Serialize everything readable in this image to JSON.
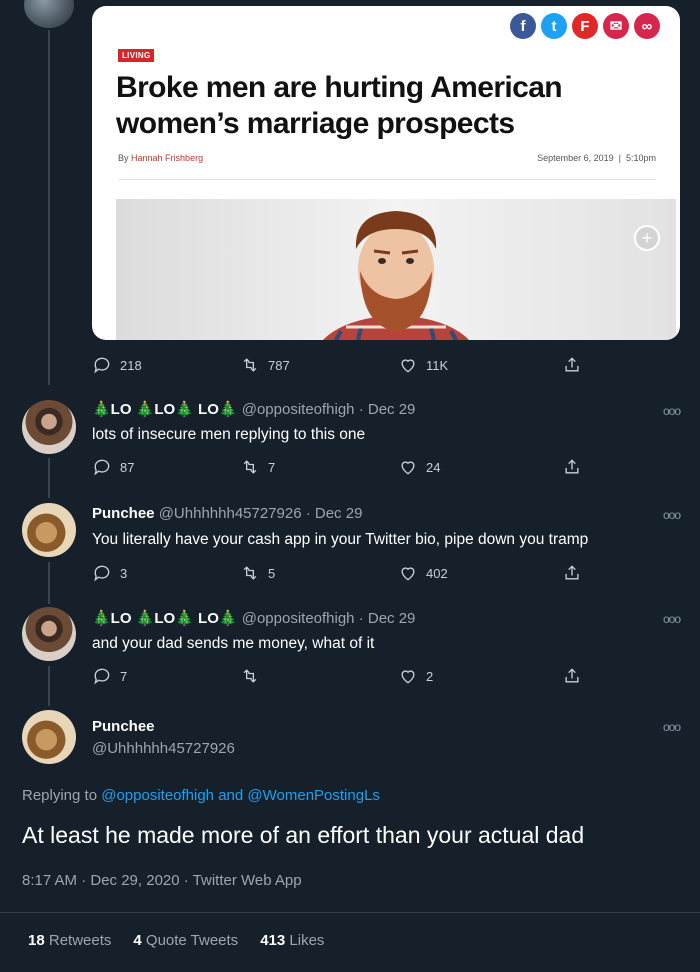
{
  "article": {
    "section_tag": "LIVING",
    "headline": "Broke men are hurting American women’s marriage prospects",
    "byline_prefix": "By",
    "author": "Hannah Frishberg",
    "date": "September 6, 2019",
    "time": "5:10pm",
    "share_icons": [
      {
        "name": "facebook-icon",
        "glyph": "f",
        "color": "#3b5998"
      },
      {
        "name": "twitter-icon",
        "glyph": "t",
        "color": "#1da1f2"
      },
      {
        "name": "flipboard-icon",
        "glyph": "F",
        "color": "#e12828"
      },
      {
        "name": "email-icon",
        "glyph": "✉",
        "color": "#d6264c"
      },
      {
        "name": "link-icon",
        "glyph": "∞",
        "color": "#d6264c"
      }
    ]
  },
  "original_actions": {
    "replies": "218",
    "retweets": "787",
    "likes": "11K"
  },
  "tweets": [
    {
      "name": "🎄LO 🎄LO🎄 LO🎄",
      "handle": "@oppositeofhigh · Dec 29",
      "text": "lots of insecure men replying to this one",
      "replies": "87",
      "retweets": "7",
      "likes": "24"
    },
    {
      "name": "Punchee",
      "handle": "@Uhhhhhh45727926 · Dec 29",
      "text": "You literally have your cash app in your Twitter bio, pipe down you tramp",
      "replies": "3",
      "retweets": "5",
      "likes": "402"
    },
    {
      "name": "🎄LO 🎄LO🎄 LO🎄",
      "handle": "@oppositeofhigh · Dec 29",
      "text": "and your dad sends me money, what of it",
      "replies": "7",
      "retweets": "",
      "likes": "2"
    }
  ],
  "expanded": {
    "name": "Punchee",
    "handle": "@Uhhhhhh45727926",
    "replying_prefix": "Replying to",
    "replying_user1": "@oppositeofhigh",
    "replying_and": "and",
    "replying_user2": "@WomenPostingLs",
    "text": "At least he made more of an effort than your actual dad",
    "meta": "8:17 AM · Dec 29, 2020 · Twitter Web App",
    "retweets_count": "18",
    "retweets_label": "Retweets",
    "quotes_count": "4",
    "quotes_label": "Quote Tweets",
    "likes_count": "413",
    "likes_label": "Likes"
  },
  "more_glyph": "ooo"
}
